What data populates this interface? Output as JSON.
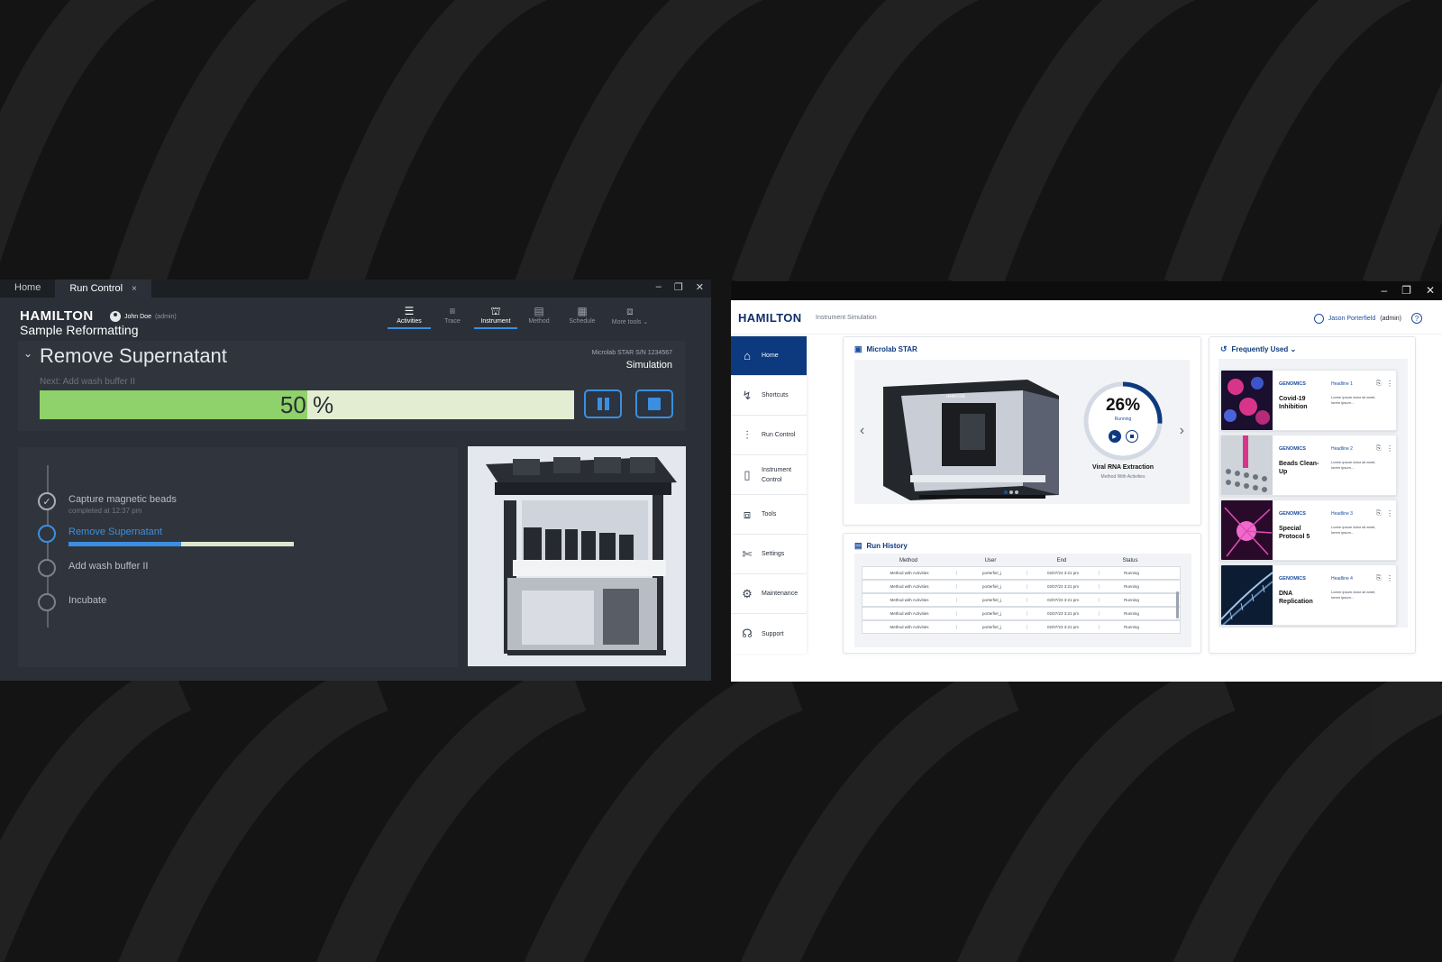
{
  "background": {
    "color": "#121212"
  },
  "run_control_window": {
    "tabs": [
      {
        "label": "Home"
      },
      {
        "label": "Run Control",
        "close": "×"
      }
    ],
    "window_controls": {
      "minimize": "–",
      "restore": "❐",
      "close": "✕"
    },
    "brand": "HAMILTON",
    "app_name": "Sample Reformatting",
    "user": {
      "name": "John Doe",
      "role": "(admin)"
    },
    "nav": [
      {
        "label": "Activities",
        "icon": "list-icon"
      },
      {
        "label": "Trace",
        "icon": "lines-icon"
      },
      {
        "label": "Instrument",
        "icon": "robot-icon"
      },
      {
        "label": "Method",
        "icon": "method-icon"
      },
      {
        "label": "Schedule",
        "icon": "calendar-icon"
      },
      {
        "label": "More tools ⌄",
        "icon": "toolbox-icon"
      }
    ],
    "current_step": {
      "title": "Remove Supernatant",
      "next": "Next: Add wash buffer II",
      "instrument": "Microlab STAR  S/N 1234567",
      "mode": "Simulation",
      "progress_label": "50 %",
      "progress": 0.5
    },
    "steps": [
      {
        "label": "Capture magnetic beads",
        "sub": "completed at 12:37 pm",
        "state": "done"
      },
      {
        "label": "Remove Supernatant",
        "state": "current",
        "progress": 0.5
      },
      {
        "label": "Add wash buffer II",
        "state": "pending"
      },
      {
        "label": "Incubate",
        "state": "pending"
      }
    ],
    "colors": {
      "accent": "#3b8fe0",
      "progress": "#8fd16a"
    }
  },
  "simulation_window": {
    "window_controls": {
      "minimize": "–",
      "restore": "❐",
      "close": "✕"
    },
    "brand": "HAMILTON",
    "subtitle": "Instrument Simulation",
    "user": {
      "name": "Jason Porterfield",
      "role": "(admin)"
    },
    "help": "?",
    "sidebar": [
      {
        "label": "Home",
        "icon": "home-icon",
        "selected": true
      },
      {
        "label": "Shortcuts",
        "icon": "shortcuts-icon"
      },
      {
        "label": "Run Control",
        "icon": "sliders-icon"
      },
      {
        "label": "Instrument Control",
        "icon": "instrument-icon"
      },
      {
        "label": "Tools",
        "icon": "toolbox-icon"
      },
      {
        "label": "Settings",
        "icon": "wrench-icon"
      },
      {
        "label": "Maintenance",
        "icon": "gear-icon"
      },
      {
        "label": "Support",
        "icon": "headset-icon"
      }
    ],
    "instrument_card": {
      "title": "Microlab STAR",
      "gauge": {
        "percent": "26%",
        "progress": 0.26,
        "status": "Running"
      },
      "run_name": "Viral RNA Extraction",
      "run_sub": "Method With Activities",
      "prev": "‹",
      "next": "›",
      "slides": 3,
      "active_slide": 0
    },
    "run_history": {
      "title": "Run History",
      "columns": [
        "Method",
        "User",
        "End",
        "Status"
      ],
      "rows": [
        [
          "Method with Activities",
          "porterfiel_j",
          "02/07/23  3:21 pm",
          "Running"
        ],
        [
          "Method with Activities",
          "porterfiel_j",
          "02/07/23  3:21 pm",
          "Running"
        ],
        [
          "Method with Activities",
          "porterfiel_j",
          "02/07/23  3:21 pm",
          "Running"
        ],
        [
          "Method with Activities",
          "porterfiel_j",
          "02/07/23  3:21 pm",
          "Running"
        ],
        [
          "Method with Activities",
          "porterfiel_j",
          "02/07/23  3:21 pm",
          "Running"
        ]
      ]
    },
    "frequently_used": {
      "title": "Frequently Used ⌄",
      "items": [
        {
          "category": "GENOMICS",
          "name": "Covid-19 Inhibition",
          "headline": "Headline 1",
          "desc": "Lorem ipsum dolor sit amet, lorem ipsum..."
        },
        {
          "category": "GENOMICS",
          "name": "Beads Clean-Up",
          "headline": "Headline 2",
          "desc": "Lorem ipsum dolor sit amet, lorem ipsum..."
        },
        {
          "category": "GENOMICS",
          "name": "Special Protocol 5",
          "headline": "Headline 3",
          "desc": "Lorem ipsum dolor sit amet, lorem ipsum..."
        },
        {
          "category": "GENOMICS",
          "name": "DNA Replication",
          "headline": "Headline 4",
          "desc": "Lorem ipsum dolor sit amet, lorem ipsum..."
        }
      ]
    },
    "colors": {
      "brand": "#0d3a7e",
      "accent": "#1d4fa0"
    }
  }
}
